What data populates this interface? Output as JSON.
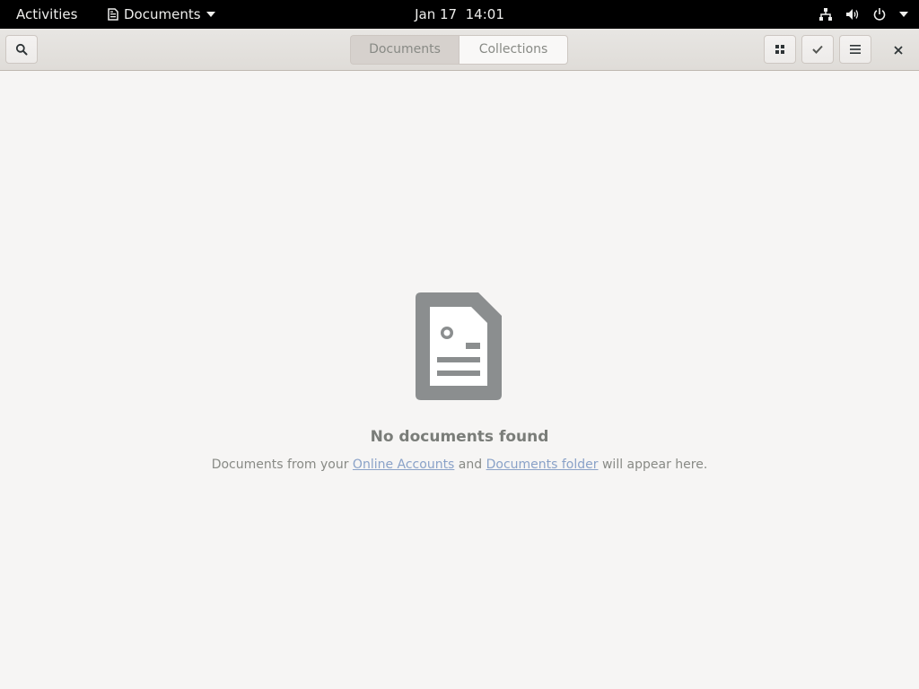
{
  "topbar": {
    "activities": "Activities",
    "app_name": "Documents",
    "clock": "Jan 17  14:01"
  },
  "headerbar": {
    "tabs": [
      {
        "label": "Documents",
        "active": true
      },
      {
        "label": "Collections",
        "active": false
      }
    ],
    "icons": {
      "search": "search-icon",
      "view": "grid-view-icon",
      "select": "checkmark-icon",
      "menu": "hamburger-menu-icon",
      "close": "close-icon"
    }
  },
  "empty_state": {
    "title": "No documents found",
    "desc_prefix": "Documents from your ",
    "link_online_accounts": "Online Accounts",
    "desc_middle": " and ",
    "link_documents_folder": "Documents folder",
    "desc_suffix": " will appear here."
  },
  "colors": {
    "background": "#f6f5f4",
    "icon_gray": "#8b8e8f",
    "link": "#8aa2c8",
    "topbar": "#000000"
  }
}
